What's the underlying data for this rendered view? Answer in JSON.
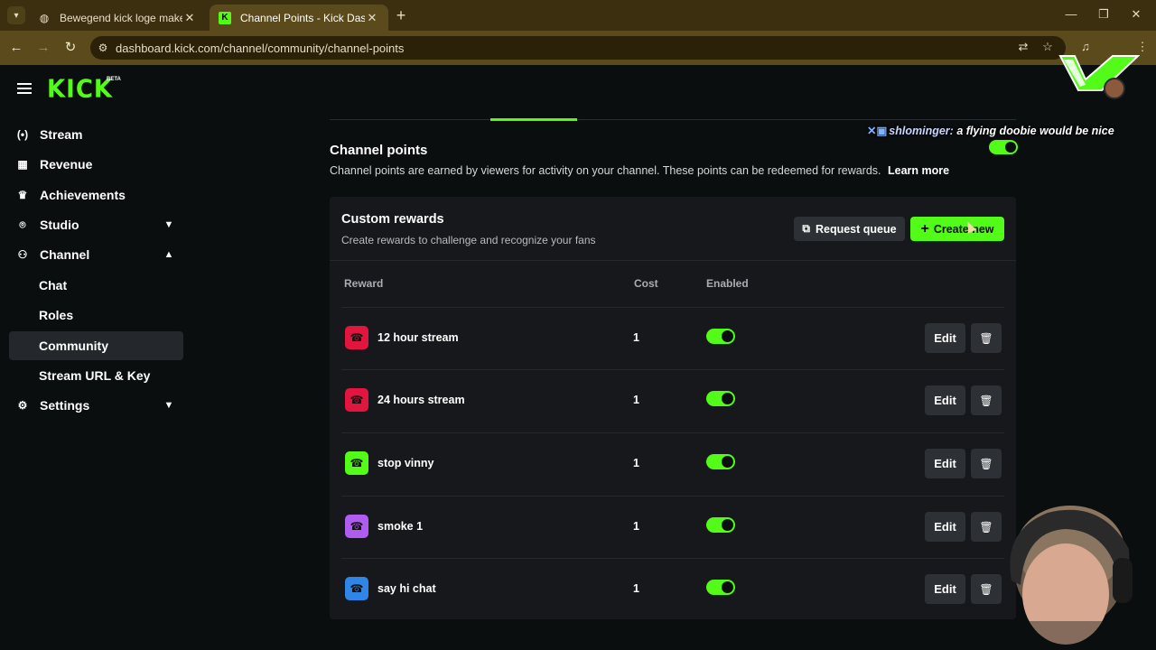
{
  "browser": {
    "tabs": [
      {
        "title": "Bewegend kick loge maken",
        "active": false
      },
      {
        "title": "Channel Points - Kick Dashboard",
        "active": true
      }
    ],
    "url": "dashboard.kick.com/channel/community/channel-points"
  },
  "header": {
    "logo": "KICK",
    "beta": "BETA"
  },
  "sidebar": {
    "items": [
      {
        "label": "Stream",
        "icon": "broadcast-icon"
      },
      {
        "label": "Revenue",
        "icon": "chart-icon"
      },
      {
        "label": "Achievements",
        "icon": "trophy-icon"
      },
      {
        "label": "Studio",
        "icon": "studio-icon",
        "expandable": true,
        "expanded": false
      },
      {
        "label": "Channel",
        "icon": "users-icon",
        "expandable": true,
        "expanded": true
      },
      {
        "label": "Chat",
        "sub": true
      },
      {
        "label": "Roles",
        "sub": true
      },
      {
        "label": "Community",
        "sub": true,
        "active": true
      },
      {
        "label": "Stream URL & Key",
        "sub": true
      },
      {
        "label": "Settings",
        "icon": "gear-icon",
        "expandable": true,
        "expanded": false
      }
    ]
  },
  "chat_overlay": {
    "username": "shlominger:",
    "message": "a flying doobie would be nice"
  },
  "channel_points": {
    "title": "Channel points",
    "description": "Channel points are earned by viewers for activity on your channel. These points can be redeemed for rewards.",
    "learn_more": "Learn more",
    "enabled": true
  },
  "custom_rewards": {
    "title": "Custom rewards",
    "subtitle": "Create rewards to challenge and recognize your fans",
    "request_queue_label": "Request queue",
    "create_new_label": "Create new",
    "columns": {
      "reward": "Reward",
      "cost": "Cost",
      "enabled": "Enabled"
    },
    "edit_label": "Edit",
    "rows": [
      {
        "name": "12 hour stream",
        "cost": "1",
        "enabled": true,
        "color": "#e2153f"
      },
      {
        "name": "24 hours stream",
        "cost": "1",
        "enabled": true,
        "color": "#e2153f"
      },
      {
        "name": "stop vinny",
        "cost": "1",
        "enabled": true,
        "color": "#53fc18"
      },
      {
        "name": "smoke 1",
        "cost": "1",
        "enabled": true,
        "color": "#b15cf0"
      },
      {
        "name": "say hi chat",
        "cost": "1",
        "enabled": true,
        "color": "#2f86e6"
      }
    ]
  },
  "colors": {
    "accent": "#53fc18",
    "background": "#0b0e0f",
    "card": "#16181b",
    "browser_chrome": "#5a4a1c"
  }
}
